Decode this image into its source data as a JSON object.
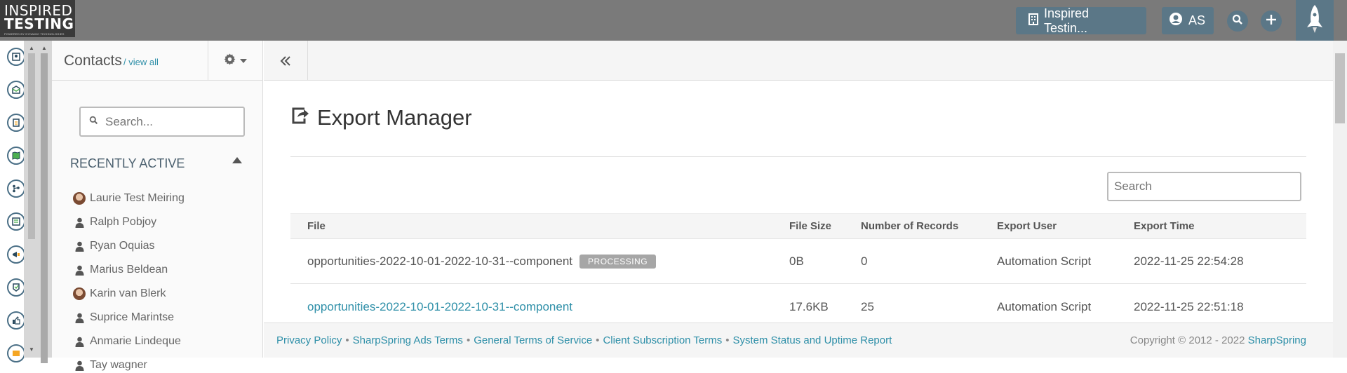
{
  "logo": {
    "line1": "INSPIRED",
    "line2": "TESTING",
    "tagline": "POWERED BY DYNAMIC TECHNOLOGIES"
  },
  "topbar": {
    "company_button": "Inspired Testin...",
    "user_initials": "AS"
  },
  "sidebar": {
    "title": "Contacts",
    "view_all": "/ view all",
    "search_placeholder": "Search...",
    "recently_active_title": "RECENTLY ACTIVE",
    "contacts": [
      {
        "name": "Laurie Test Meiring",
        "avatar": "photo"
      },
      {
        "name": "Ralph Pobjoy",
        "avatar": "user-icon"
      },
      {
        "name": "Ryan Oquias",
        "avatar": "user-icon"
      },
      {
        "name": "Marius Beldean",
        "avatar": "user-icon"
      },
      {
        "name": "Karin van Blerk",
        "avatar": "photo"
      },
      {
        "name": "Suprice Marintse",
        "avatar": "user-icon"
      },
      {
        "name": "Anmarie Lindeque",
        "avatar": "user-icon"
      },
      {
        "name": "Tay wagner",
        "avatar": "user-icon"
      }
    ]
  },
  "main": {
    "title": "Export Manager",
    "search_placeholder": "Search",
    "columns": [
      "File",
      "File Size",
      "Number of Records",
      "Export User",
      "Export Time"
    ],
    "rows": [
      {
        "file": "opportunities-2022-10-01-2022-10-31--component",
        "badge": "PROCESSING",
        "is_link": false,
        "size": "0B",
        "records": "0",
        "user": "Automation Script",
        "time": "2022-11-25 22:54:28"
      },
      {
        "file": "opportunities-2022-10-01-2022-10-31--component",
        "badge": "",
        "is_link": true,
        "size": "17.6KB",
        "records": "25",
        "user": "Automation Script",
        "time": "2022-11-25 22:51:18"
      }
    ]
  },
  "footer": {
    "links": [
      "Privacy Policy",
      "SharpSpring Ads Terms",
      "General Terms of Service",
      "Client Subscription Terms",
      "System Status and Uptime Report"
    ],
    "separator": "•",
    "copyright_text": "Copyright © 2012 - 2022 ",
    "copyright_link": "SharpSpring"
  },
  "colors": {
    "accent": "#2e8fa8",
    "topbar": "#7a7a7a",
    "button": "#5b7787",
    "badge": "#a6a6a6"
  }
}
